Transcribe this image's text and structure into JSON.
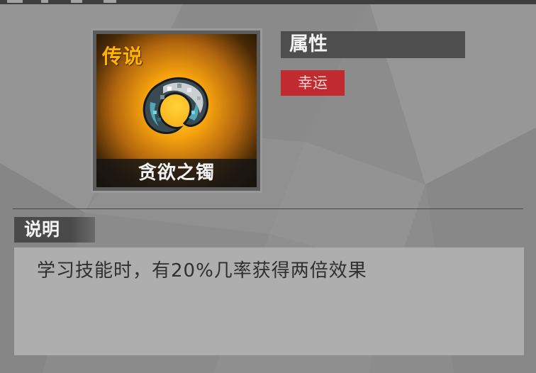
{
  "item": {
    "rarity": "传说",
    "name": "贪欲之镯",
    "icon": "bracelet-icon"
  },
  "attributes": {
    "header": "属性",
    "tags": [
      "幸运"
    ]
  },
  "description": {
    "header": "说明",
    "text": "学习技能时，有20%几率获得两倍效果"
  },
  "colors": {
    "rarity": "#ffb400",
    "tag": "#c12a2e",
    "panel_header": "#4e4e4e",
    "background": "#8e8e8e"
  }
}
